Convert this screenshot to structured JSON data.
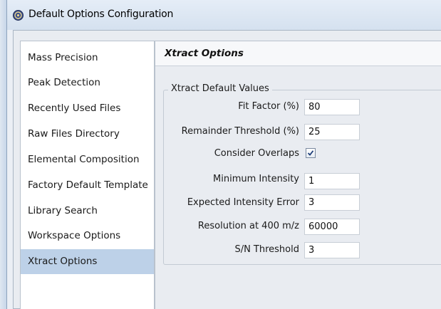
{
  "window": {
    "title": "Default Options Configuration",
    "icon": "app-icon"
  },
  "nav": {
    "items": [
      {
        "label": "Mass Precision",
        "selected": false
      },
      {
        "label": "Peak Detection",
        "selected": false
      },
      {
        "label": "Recently Used Files",
        "selected": false
      },
      {
        "label": "Raw Files Directory",
        "selected": false
      },
      {
        "label": "Elemental Composition",
        "selected": false
      },
      {
        "label": "Factory Default Template",
        "selected": false
      },
      {
        "label": "Library Search",
        "selected": false
      },
      {
        "label": "Workspace Options",
        "selected": false
      },
      {
        "label": "Xtract Options",
        "selected": true
      }
    ]
  },
  "panel": {
    "title": "Xtract Options",
    "group_title": "Xtract Default Values",
    "fields": [
      {
        "label": "Fit Factor (%)",
        "value": "80"
      },
      {
        "label": "Remainder Threshold (%)",
        "value": "25"
      },
      {
        "label": "Consider Overlaps",
        "checked": true
      },
      {
        "label": "Minimum Intensity",
        "value": "1"
      },
      {
        "label": "Expected Intensity Error",
        "value": "3"
      },
      {
        "label": "Resolution at 400 m/z",
        "value": "60000"
      },
      {
        "label": "S/N Threshold",
        "value": "3"
      }
    ]
  },
  "colors": {
    "selected_item": "#bdd1e8",
    "titlebar": "#dce6f2"
  }
}
